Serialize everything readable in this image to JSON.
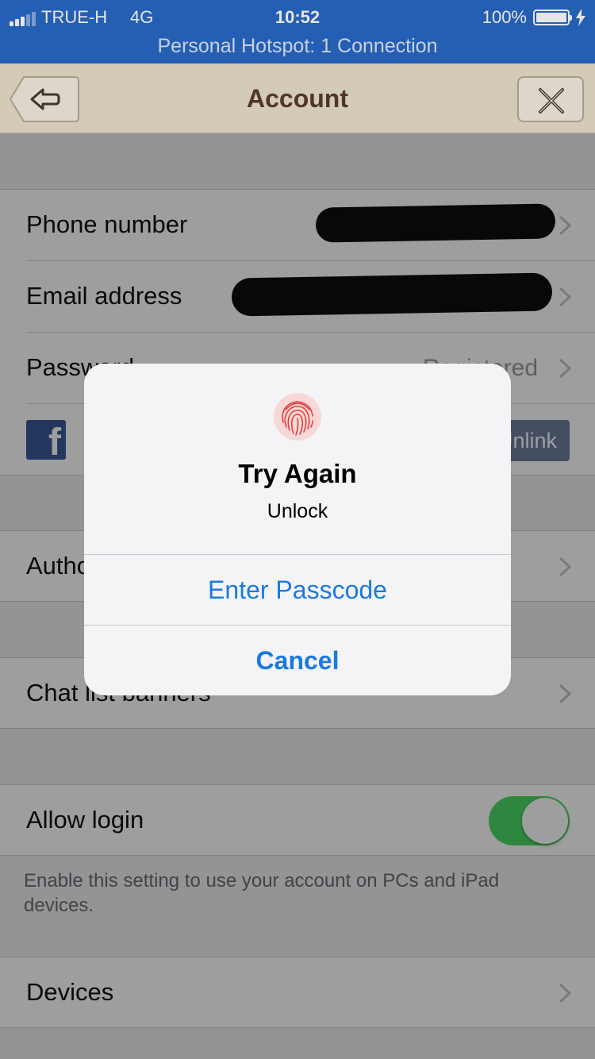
{
  "status_bar": {
    "carrier": "TRUE-H",
    "network": "4G",
    "time": "10:52",
    "battery_percent": "100%",
    "hotspot": "Personal Hotspot: 1 Connection"
  },
  "nav": {
    "title": "Account",
    "back_icon": "back-arrow-icon",
    "close_icon": "close-icon"
  },
  "account": {
    "phone_label": "Phone number",
    "email_label": "Email address",
    "password_label": "Password",
    "password_value": "Registered",
    "facebook_icon": "facebook-icon",
    "facebook_action": "Unlink"
  },
  "auth_row": {
    "label": "Authorized apps"
  },
  "chat_row": {
    "label": "Chat list banners"
  },
  "login": {
    "label": "Allow login",
    "enabled": true,
    "note": "Enable this setting to use your account on PCs and iPad devices."
  },
  "devices_row": {
    "label": "Devices"
  },
  "alert": {
    "icon": "fingerprint-icon",
    "title": "Try Again",
    "message": "Unlock",
    "primary_action": "Enter Passcode",
    "cancel_action": "Cancel"
  },
  "colors": {
    "status_bar": "#2a6ac8",
    "nav_bar": "#ede3cc",
    "nav_title": "#5a3e2e",
    "toggle_on": "#4cd964",
    "alert_action": "#1a7ae0",
    "facebook": "#3b5998",
    "fingerprint": "#e0403f"
  }
}
